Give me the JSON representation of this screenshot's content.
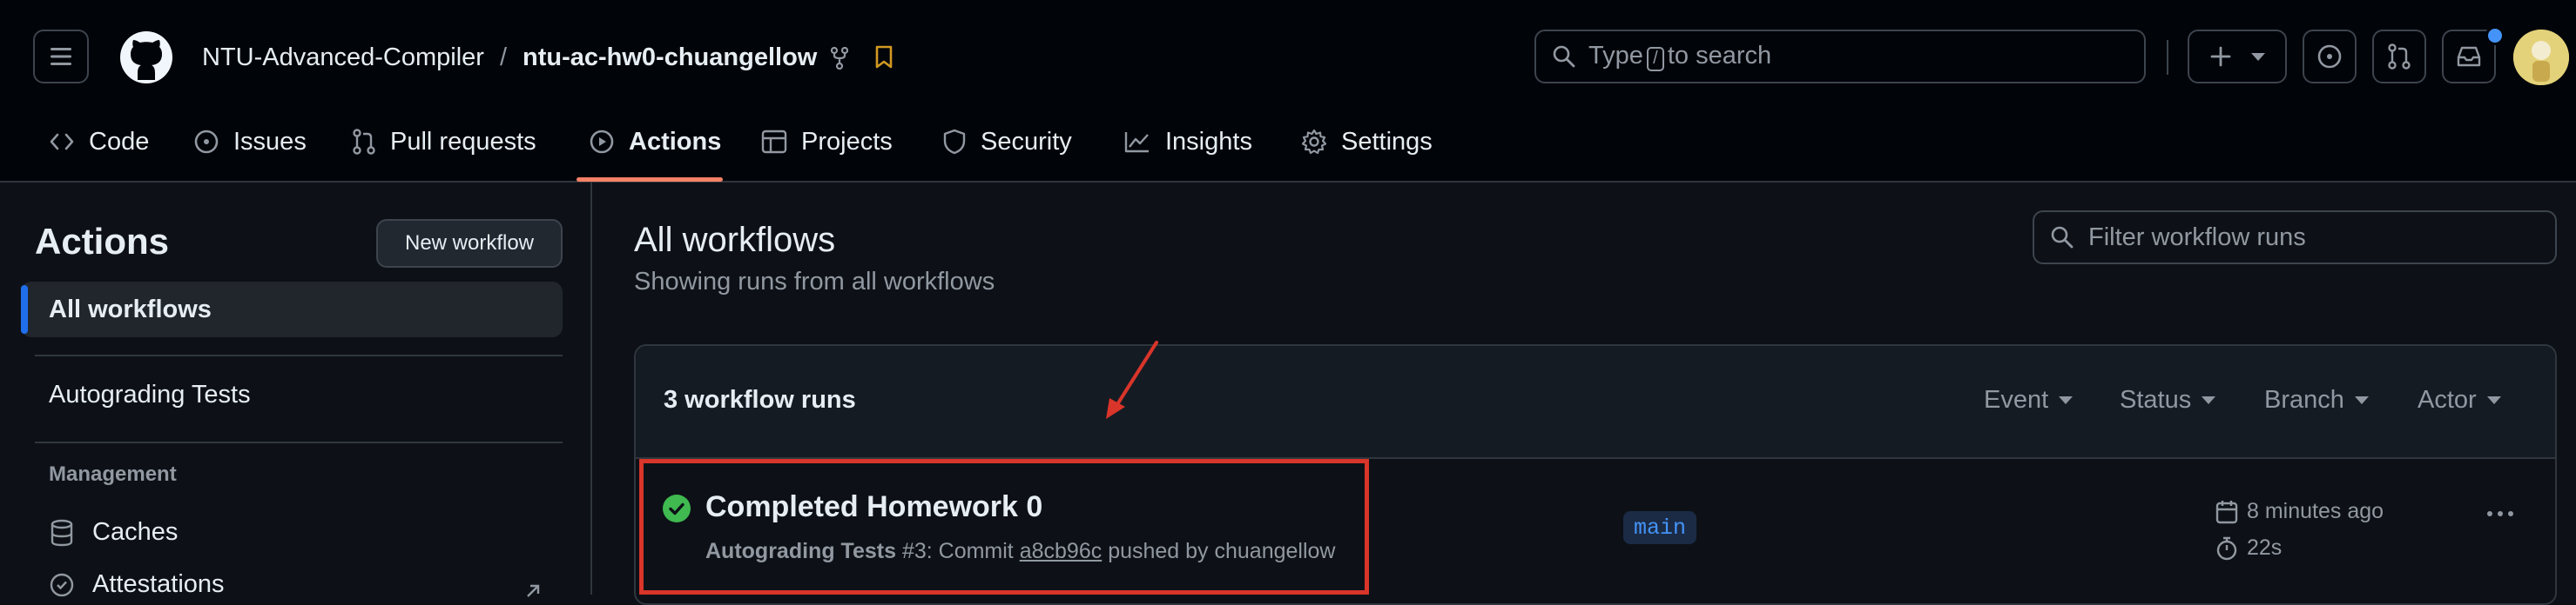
{
  "header": {
    "org": "NTU-Advanced-Compiler",
    "separator": "/",
    "repo": "ntu-ac-hw0-chuangellow",
    "search_text_before": "Type",
    "search_key": "/",
    "search_text_after": "to search",
    "icons": [
      "menu-icon",
      "github-logo",
      "fork-icon",
      "bookmark-icon",
      "search-icon",
      "plus-icon",
      "issue-icon",
      "pull-request-icon",
      "inbox-icon",
      "avatar"
    ]
  },
  "tabs": [
    {
      "label": "Code",
      "icon": "code-icon"
    },
    {
      "label": "Issues",
      "icon": "issue-icon"
    },
    {
      "label": "Pull requests",
      "icon": "pull-request-icon"
    },
    {
      "label": "Actions",
      "icon": "play-icon",
      "selected": true
    },
    {
      "label": "Projects",
      "icon": "table-icon"
    },
    {
      "label": "Security",
      "icon": "shield-icon"
    },
    {
      "label": "Insights",
      "icon": "graph-icon"
    },
    {
      "label": "Settings",
      "icon": "gear-icon"
    }
  ],
  "sidebar": {
    "title": "Actions",
    "new_workflow": "New workflow",
    "all_workflows": "All workflows",
    "workflow_item": "Autograding Tests",
    "management_heading": "Management",
    "caches": "Caches",
    "attestations": "Attestations"
  },
  "main": {
    "title": "All workflows",
    "subtitle": "Showing runs from all workflows",
    "filter_placeholder": "Filter workflow runs",
    "runs_count": "3 workflow runs",
    "filters": [
      "Event",
      "Status",
      "Branch",
      "Actor"
    ]
  },
  "run": {
    "title": "Completed Homework 0",
    "workflow": "Autograding Tests",
    "number": "#3",
    "commit_prefix": ": Commit",
    "commit": "a8cb96c",
    "pushed_by": "pushed by chuangellow",
    "branch": "main",
    "time_ago": "8 minutes ago",
    "duration": "22s",
    "status": "success"
  },
  "colors": {
    "accent_blue": "#1f6feb",
    "tab_underline": "#f78166",
    "success_green": "#3fb950",
    "annotation_red": "#d9352a"
  }
}
